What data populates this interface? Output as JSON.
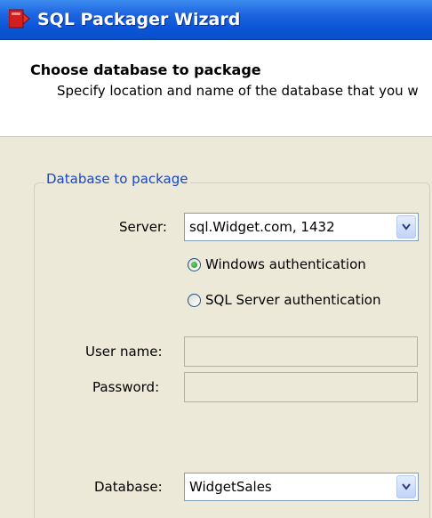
{
  "window": {
    "title": "SQL Packager Wizard",
    "app_icon": "sql-packager-icon"
  },
  "header": {
    "title": "Choose database to package",
    "subtitle": "Specify location and name of the database that you w"
  },
  "group": {
    "label": "Database to package"
  },
  "server": {
    "label": "Server:",
    "value": "sql.Widget.com, 1432"
  },
  "auth": {
    "windows_label": "Windows authentication",
    "sql_label": "SQL Server authentication",
    "selected": "windows"
  },
  "credentials": {
    "username_label": "User name:",
    "username_value": "",
    "password_label": "Password:",
    "password_value": ""
  },
  "database": {
    "label": "Database:",
    "value": "WidgetSales"
  },
  "colors": {
    "titlebar": "#0a55d8",
    "accent": "#1846c8",
    "dialog_bg": "#ece9d8"
  }
}
